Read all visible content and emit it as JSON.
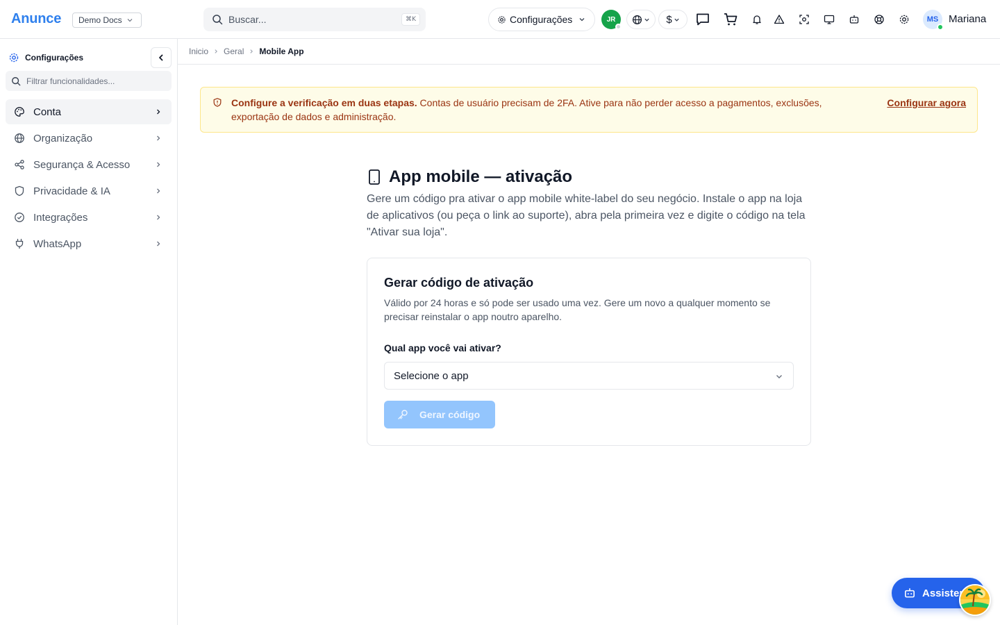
{
  "header": {
    "brand": "Anunce",
    "workspace": "Demo Docs",
    "search_placeholder": "Buscar...",
    "search_shortcut": "⌘K",
    "settings_label": "Configurações",
    "org_initials": "JR",
    "currency_symbol": "$",
    "user_initials": "MS",
    "user_name": "Mariana"
  },
  "sidebar": {
    "title": "Configurações",
    "filter_placeholder": "Filtrar funcionalidades...",
    "items": [
      {
        "label": "Conta",
        "icon": "palette-icon"
      },
      {
        "label": "Organização",
        "icon": "globe-icon"
      },
      {
        "label": "Segurança & Acesso",
        "icon": "share-icon"
      },
      {
        "label": "Privacidade & IA",
        "icon": "shield-icon"
      },
      {
        "label": "Integrações",
        "icon": "check-circle-icon"
      },
      {
        "label": "WhatsApp",
        "icon": "plug-icon"
      }
    ]
  },
  "breadcrumb": {
    "items": [
      "Inicio",
      "Geral"
    ],
    "current": "Mobile App"
  },
  "alert": {
    "title": "Configure a verificação em duas etapas.",
    "message": "Contas de usuário precisam de 2FA. Ative para não perder acesso a pagamentos, exclusões, exportação de dados e administração.",
    "action": "Configurar agora"
  },
  "page": {
    "title": "App mobile — ativação",
    "description": "Gere um código pra ativar o app mobile white-label do seu negócio. Instale o app na loja de aplicativos (ou peça o link ao suporte), abra pela primeira vez e digite o código na tela \"Ativar sua loja\"."
  },
  "card": {
    "title": "Gerar código de ativação",
    "description": "Válido por 24 horas e só pode ser usado uma vez. Gere um novo a qualquer momento se precisar reinstalar o app noutro aparelho.",
    "field_label": "Qual app você vai ativar?",
    "select_placeholder": "Selecione o app",
    "button_label": "Gerar código"
  },
  "assistant": {
    "label": "Assistente"
  },
  "colors": {
    "brand": "#2f80ed",
    "primary_button_disabled": "#93c5fd",
    "alert_bg": "#fefce8",
    "alert_text": "#9a3412",
    "online": "#22c55e"
  }
}
